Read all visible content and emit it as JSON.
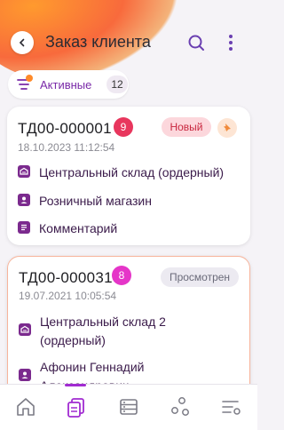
{
  "header": {
    "title": "Заказ клиента"
  },
  "filter": {
    "label": "Активные",
    "count": "12"
  },
  "orders": [
    {
      "number": "ТД00-000001",
      "badge": "9",
      "status": "Новый",
      "date": "18.10.2023 11:12:54",
      "rows": [
        {
          "icon": "warehouse-icon",
          "text": "Центральный склад (ордерный)"
        },
        {
          "icon": "contact-icon",
          "text": "Розничный магазин"
        },
        {
          "icon": "comment-icon",
          "text": "Комментарий"
        }
      ]
    },
    {
      "number": "ТД00-000031",
      "badge": "8",
      "status": "Просмотрен",
      "date": "19.07.2021 10:05:54",
      "rows": [
        {
          "icon": "warehouse-icon",
          "text": "Центральный склад 2"
        },
        {
          "icon": "warehouse-icon",
          "text_cont": "(ордерный)"
        },
        {
          "icon": "contact-icon",
          "text": "Афонин Геннадий"
        },
        {
          "icon": "contact-icon",
          "text_cont": "Александрович"
        }
      ]
    }
  ],
  "colors": {
    "accent": "#a12bd1",
    "badge1": "#e8365d",
    "badge2": "#e535c8",
    "status_new_bg": "#fcd7dc",
    "status_new_text": "#c8273f",
    "status_viewed_bg": "#eceaf1",
    "status_viewed_text": "#6b6b7a"
  },
  "nav": [
    "home-icon",
    "orders-icon",
    "catalog-icon",
    "share-icon",
    "settings-icon"
  ]
}
